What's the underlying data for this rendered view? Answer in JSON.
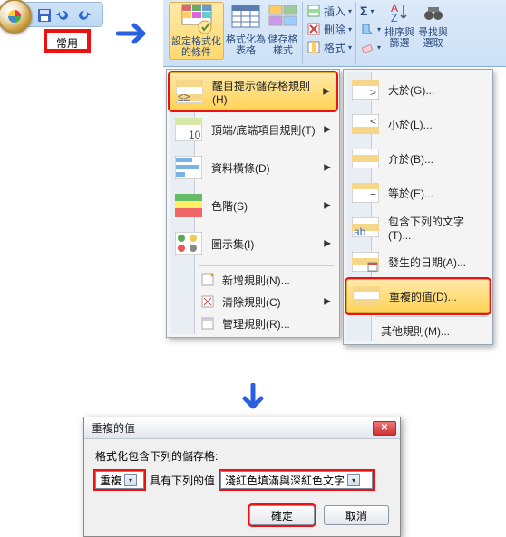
{
  "qat": {
    "tab_home": "常用"
  },
  "ribbon": {
    "cond_fmt": "設定格式化\n的條件",
    "fmt_table": "格式化為\n表格",
    "cell_styles": "儲存格\n樣式",
    "insert": "插入",
    "delete": "刪除",
    "format": "格式",
    "sigma": "Σ",
    "sort_filter": "排序與\n篩選",
    "find_select": "尋找與\n選取"
  },
  "menu1": {
    "highlight_rules": "醒目提示儲存格規則(H)",
    "top_bottom": "頂端/底端項目規則(T)",
    "data_bars": "資料橫條(D)",
    "color_scales": "色階(S)",
    "icon_sets": "圖示集(I)",
    "new_rule": "新增規則(N)...",
    "clear_rules": "清除規則(C)",
    "manage_rules": "管理規則(R)..."
  },
  "menu2": {
    "greater": "大於(G)...",
    "less": "小於(L)...",
    "between": "介於(B)...",
    "equal": "等於(E)...",
    "text_contains": "包含下列的文字(T)...",
    "date_occurring": "發生的日期(A)...",
    "duplicate": "重複的值(D)...",
    "more_rules": "其他規則(M)..."
  },
  "dialog": {
    "title": "重複的值",
    "subtitle": "格式化包含下列的儲存格:",
    "combo1": "重複",
    "mid_label": "具有下列的值",
    "combo2": "淺紅色填滿與深紅色文字",
    "ok": "確定",
    "cancel": "取消"
  }
}
